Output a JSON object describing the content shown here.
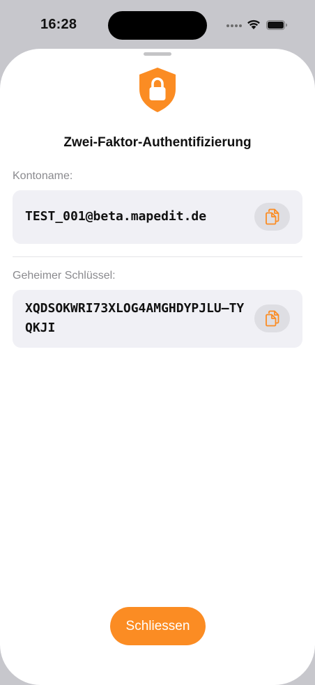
{
  "status_bar": {
    "time": "16:28"
  },
  "colors": {
    "accent": "#fb8c23",
    "field_background": "#f0f0f5",
    "label_gray": "#8a8a8e"
  },
  "icons": {
    "header": "shield-lock-icon",
    "copy": "copy-doc-icon"
  },
  "sheet": {
    "title": "Zwei-Faktor-Authentifizierung",
    "account": {
      "label": "Kontoname:",
      "value": "TEST_001@beta.mapedit.de"
    },
    "secret": {
      "label": "Geheimer Schlüssel:",
      "value": "XQDSOKWRI73XLOG4AMGHDYPJLU–TYQKJI"
    },
    "close_label": "Schliessen"
  }
}
